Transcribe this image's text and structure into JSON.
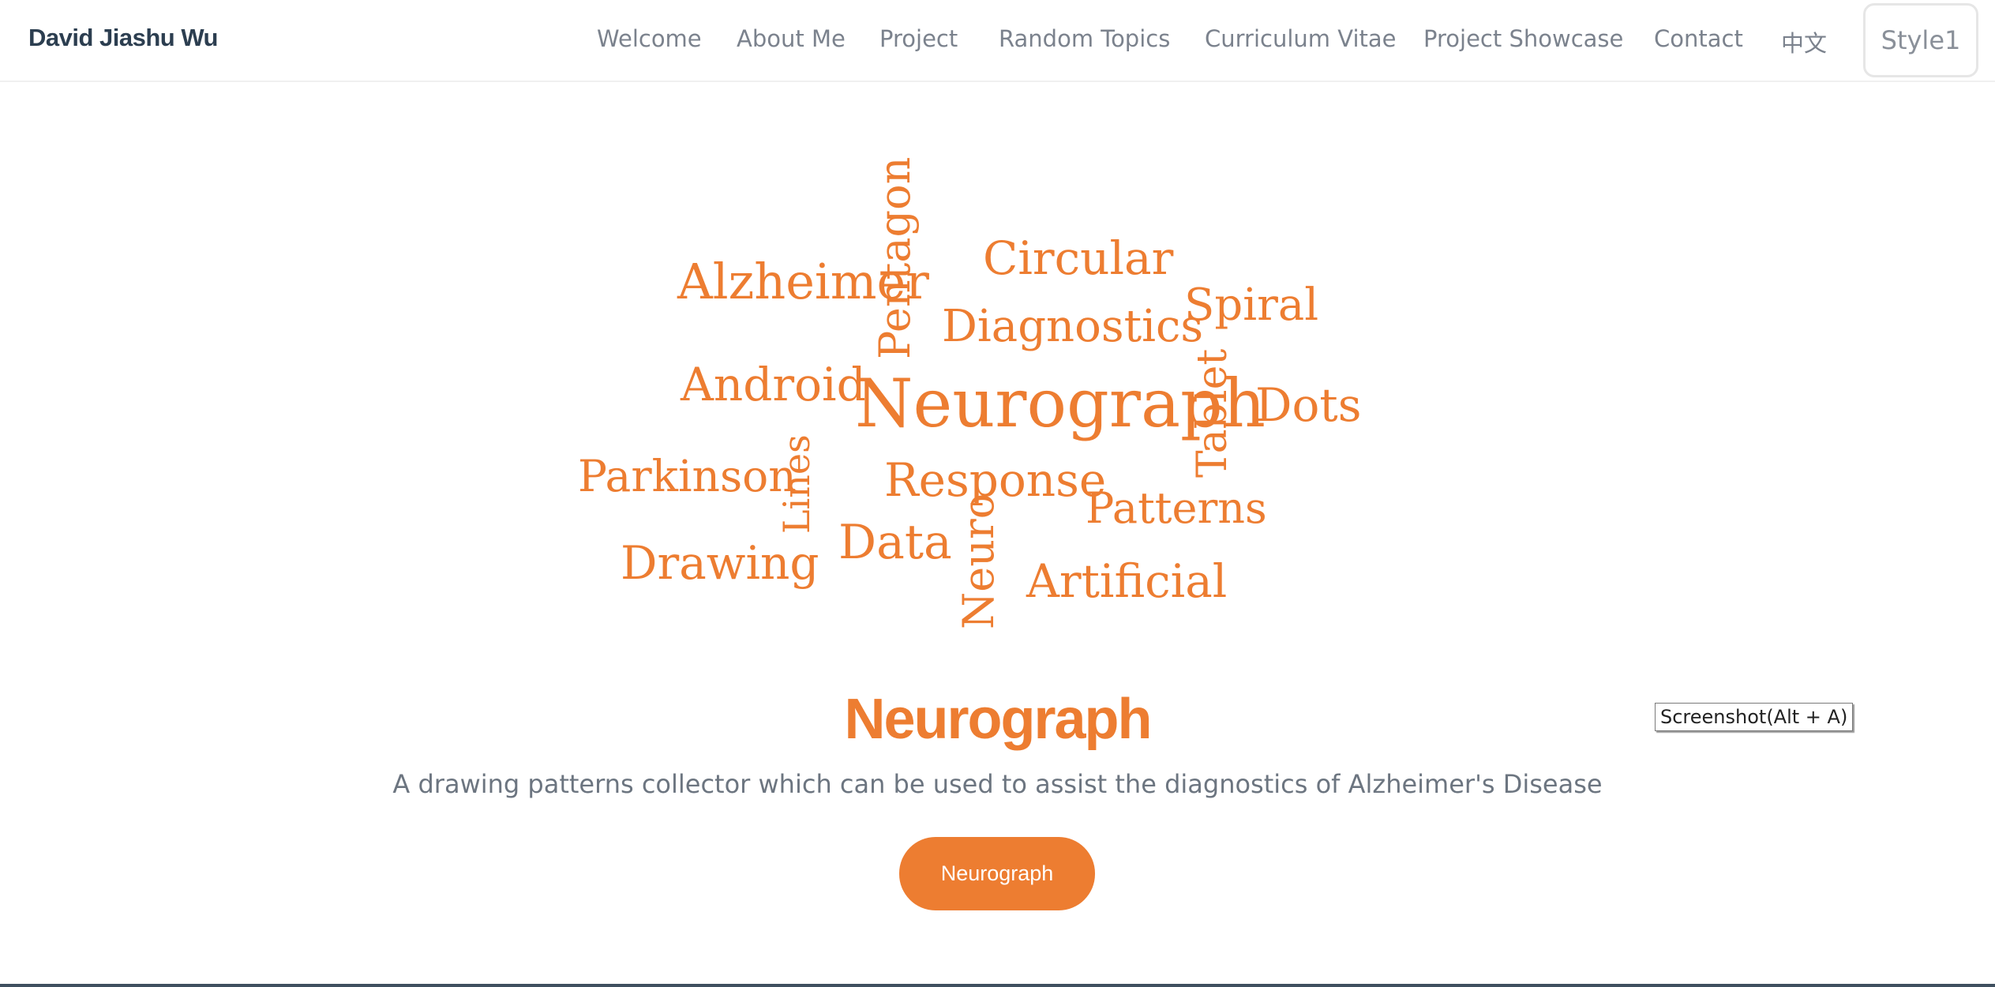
{
  "header": {
    "brand": "David Jiashu Wu",
    "nav": [
      {
        "label": "Welcome"
      },
      {
        "label": "About Me"
      },
      {
        "label": "Project"
      },
      {
        "label": "Random Topics"
      },
      {
        "label": "Curriculum Vitae"
      },
      {
        "label": "Project Showcase"
      },
      {
        "label": "Contact"
      },
      {
        "label": "中文"
      }
    ],
    "style_button": "Style1"
  },
  "wordcloud": {
    "color": "#ed7d31",
    "words": [
      "Alzheimer",
      "Pentagon",
      "Circular",
      "Diagnostics",
      "Spiral",
      "Android",
      "Neurograph",
      "Tablet",
      "Dots",
      "Parkinson",
      "Lines",
      "Response",
      "Patterns",
      "Drawing",
      "Data",
      "Neuro",
      "Artificial"
    ]
  },
  "main": {
    "title": "Neurograph",
    "subtitle": "A drawing patterns collector which can be used to assist the diagnostics of Alzheimer's Disease",
    "cta_label": "Neurograph"
  },
  "tooltip": "Screenshot(Alt + A)",
  "colors": {
    "accent": "#ed7d31",
    "brand_text": "#2c3e50",
    "nav_text": "#7b828d"
  }
}
